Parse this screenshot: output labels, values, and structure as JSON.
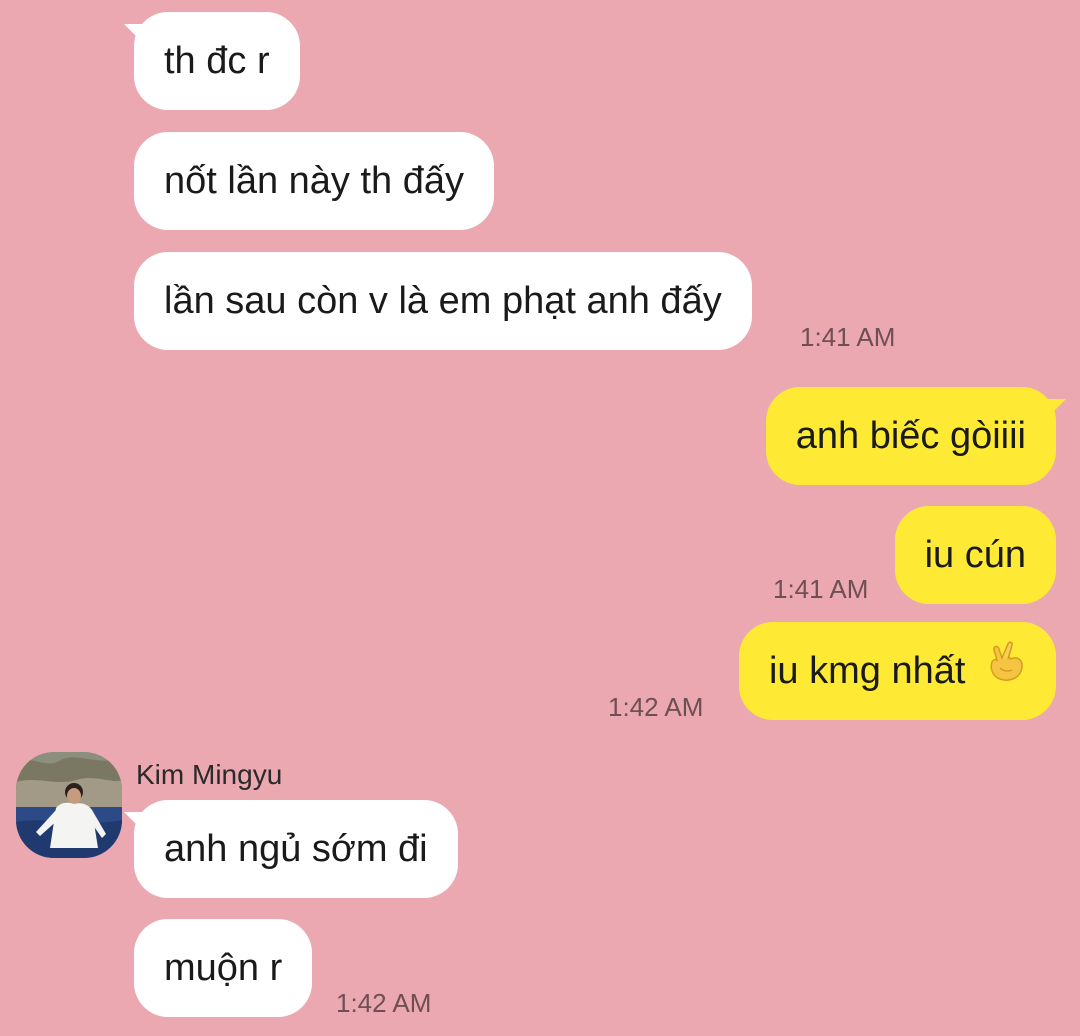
{
  "colors": {
    "background": "#EBA8B0",
    "incoming_bubble": "#FFFFFF",
    "outgoing_bubble": "#FEEA35"
  },
  "messages": {
    "in_1": "th đc r",
    "in_2": "nốt lần này th đấy",
    "in_3": "lần sau còn v là em phạt anh đấy",
    "in_3_time": "1:41 AM",
    "out_1": "anh biếc gòiiii",
    "out_2": "iu cún",
    "out_2_time": "1:41 AM",
    "out_3": "iu kmg nhất",
    "out_3_emoji": "finger-heart-emoji",
    "out_3_time": "1:42 AM",
    "sender_name": "Kim Mingyu",
    "in_4": "anh ngủ sớm đi",
    "in_5": "muộn r",
    "in_5_time": "1:42 AM"
  }
}
